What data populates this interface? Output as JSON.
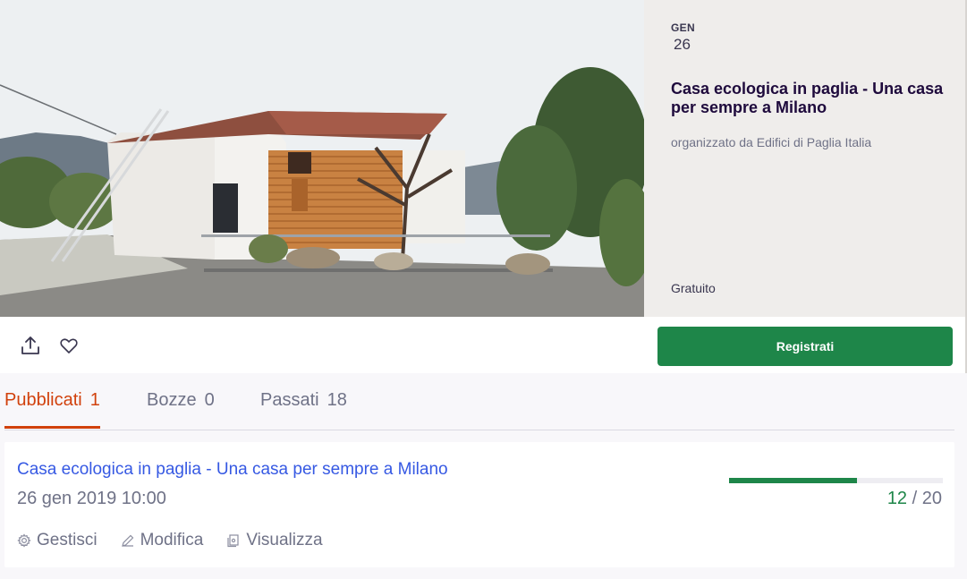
{
  "event": {
    "month": "GEN",
    "day": "26",
    "title": "Casa ecologica in paglia - Una casa per sempre a Milano",
    "organizer": "organizzato da Edifici di Paglia Italia",
    "price": "Gratuito",
    "register_label": "Registrati",
    "icons": [
      "share-icon",
      "heart-icon"
    ]
  },
  "tabs": [
    {
      "label": "Pubblicati",
      "count": "1",
      "active": true
    },
    {
      "label": "Bozze",
      "count": "0",
      "active": false
    },
    {
      "label": "Passati",
      "count": "18",
      "active": false
    }
  ],
  "listing": {
    "title": "Casa ecologica in paglia - Una casa per sempre a Milano",
    "datetime": "26 gen 2019 10:00",
    "sold": "12",
    "capacity": "20",
    "sold_separator": "/",
    "progress_fraction": 0.6,
    "actions": [
      {
        "label": "Gestisci",
        "icon": "gear-icon"
      },
      {
        "label": "Modifica",
        "icon": "pencil-icon"
      },
      {
        "label": "Visualizza",
        "icon": "view-page-icon"
      }
    ]
  },
  "colors": {
    "accent_green": "#1e8649",
    "tab_active": "#d1410c",
    "link_blue": "#3659e3"
  }
}
